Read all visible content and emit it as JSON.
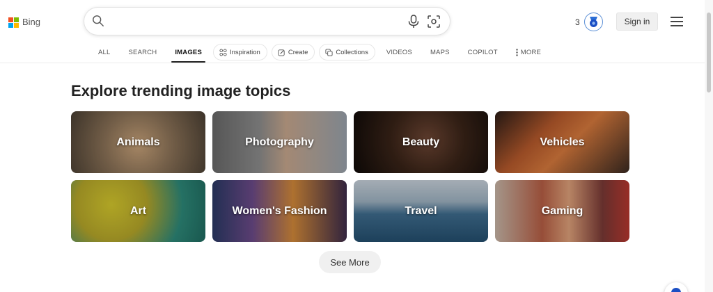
{
  "brand": {
    "name": "Bing",
    "square_colors": [
      "#f25022",
      "#7fba00",
      "#00a4ef",
      "#ffb900"
    ]
  },
  "search": {
    "value": "",
    "placeholder": "",
    "search_icon": "search-icon",
    "mic_icon": "microphone-icon",
    "visual_search_icon": "visual-search-icon"
  },
  "header": {
    "rewards_count": "3",
    "rewards_icon": "rewards-medal-icon",
    "signin_label": "Sign in",
    "menu_icon": "hamburger-menu-icon"
  },
  "nav": {
    "all": "ALL",
    "search": "SEARCH",
    "images": "IMAGES",
    "inspiration": "Inspiration",
    "create": "Create",
    "collections": "Collections",
    "videos": "VIDEOS",
    "maps": "MAPS",
    "copilot": "COPILOT",
    "more": "MORE"
  },
  "main": {
    "title": "Explore trending image topics",
    "topics": [
      "Animals",
      "Photography",
      "Beauty",
      "Vehicles",
      "Art",
      "Women's Fashion",
      "Travel",
      "Gaming"
    ],
    "see_more": "See More"
  },
  "colors": {
    "accent": "#1b4fc4",
    "rewards_ring": "#5a8fd6"
  }
}
